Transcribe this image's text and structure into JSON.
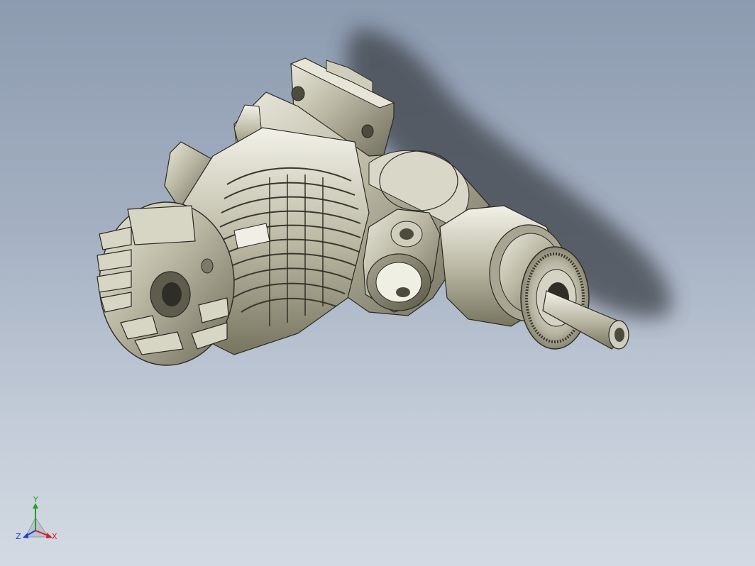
{
  "viewport": {
    "background_top": "#8d9bb0",
    "background_bottom": "#d3dae3",
    "model": "engine-assembly-3d-model"
  },
  "triad": {
    "x_label": "X",
    "y_label": "Y",
    "z_label": "Z",
    "x_color": "#d42020",
    "y_color": "#2a9a2a",
    "z_color": "#1f3fd0"
  }
}
